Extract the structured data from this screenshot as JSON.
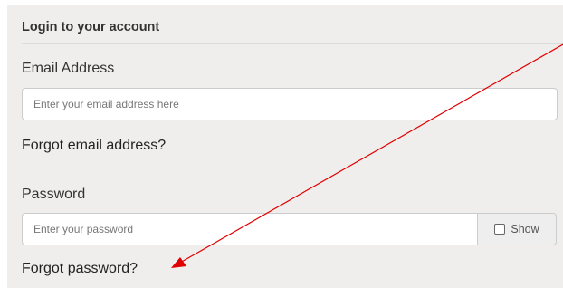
{
  "panel": {
    "heading": "Login to your account"
  },
  "email": {
    "label": "Email Address",
    "placeholder": "Enter your email address here",
    "value": "",
    "forgot_link": "Forgot email address?"
  },
  "password": {
    "label": "Password",
    "placeholder": "Enter your password",
    "value": "",
    "show_label": "Show",
    "show_checked": false,
    "forgot_link": "Forgot password?"
  },
  "annotation": {
    "color": "#e00000",
    "icon": "arrow-icon"
  }
}
